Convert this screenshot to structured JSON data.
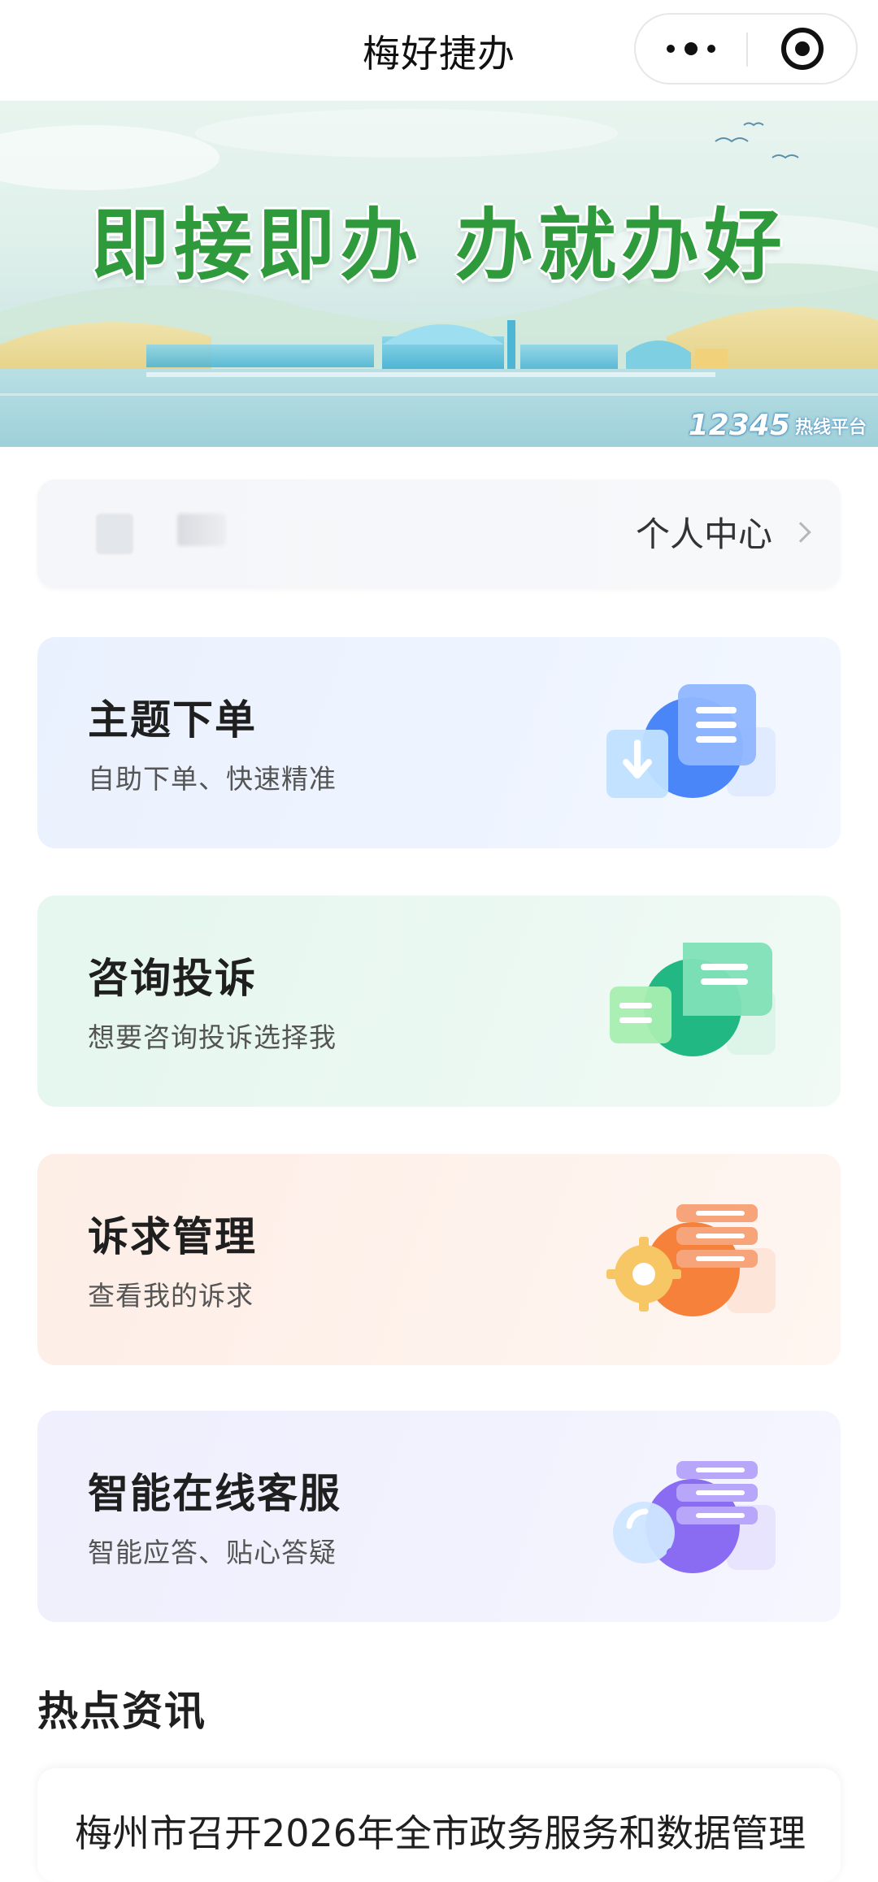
{
  "header": {
    "title": "梅好捷办",
    "more_icon": "more-dots-icon",
    "close_icon": "target-icon"
  },
  "banner": {
    "slogan": "即接即办  办就办好",
    "hotline": "12345",
    "hotline_label": "热线平台"
  },
  "user": {
    "center_label": "个人中心"
  },
  "features": [
    {
      "title": "主题下单",
      "subtitle": "自助下单、快速精准",
      "icon": "download-document-icon",
      "accent": "#4a86f7"
    },
    {
      "title": "咨询投诉",
      "subtitle": "想要咨询投诉选择我",
      "icon": "chat-bubbles-icon",
      "accent": "#22b883"
    },
    {
      "title": "诉求管理",
      "subtitle": "查看我的诉求",
      "icon": "gear-list-icon",
      "accent": "#f5813a"
    },
    {
      "title": "智能在线客服",
      "subtitle": "智能应答、贴心答疑",
      "icon": "search-service-icon",
      "accent": "#8a6cf2"
    }
  ],
  "news": {
    "heading": "热点资讯",
    "items": [
      {
        "title": "梅州市召开2026年全市政务服务和数据管理"
      }
    ]
  }
}
